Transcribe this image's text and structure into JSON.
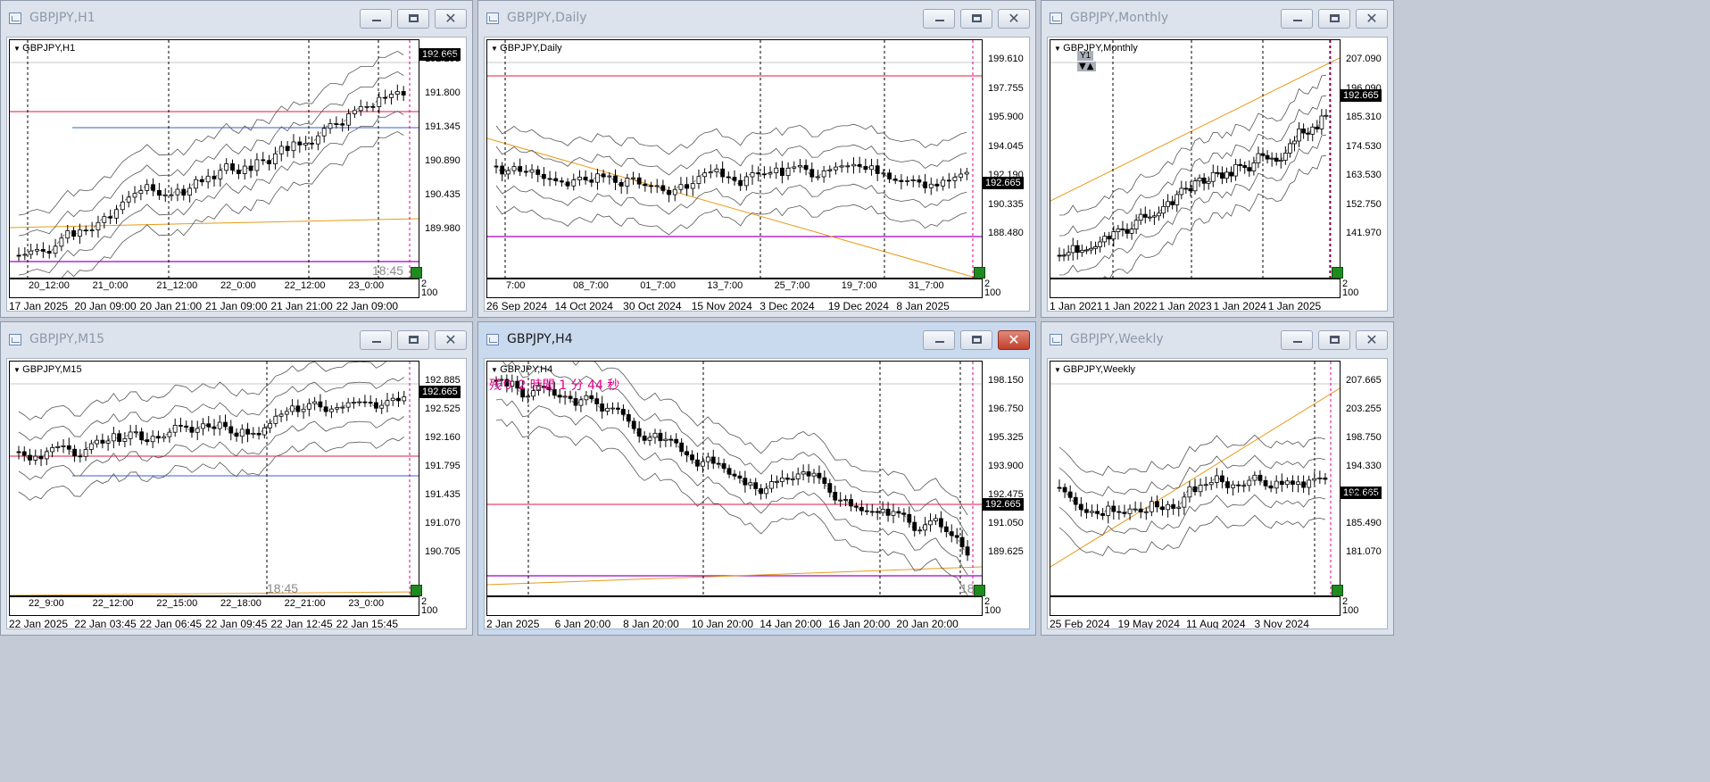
{
  "price": "192.665",
  "icons": {
    "window": "chart-window-icon"
  },
  "windows": [
    {
      "id": "h1",
      "title": "GBPJPY,H1",
      "label": "GBPJPY,H1",
      "active": false,
      "yticks": [
        "192.255",
        "191.800",
        "191.345",
        "190.890",
        "190.435",
        "189.980"
      ],
      "xticks": [
        "17 Jan 2025",
        "20 Jan 09:00",
        "20 Jan 21:00",
        "21 Jan 09:00",
        "21 Jan 21:00",
        "22 Jan 09:00"
      ],
      "sep": [
        "20_12:00",
        "21_0:00",
        "21_12:00",
        "22_0:00",
        "22_12:00",
        "23_0:00"
      ],
      "scale_top": "2",
      "scale_bottom": "100",
      "time": "18:45"
    },
    {
      "id": "daily",
      "title": "GBPJPY,Daily",
      "label": "GBPJPY,Daily",
      "active": false,
      "yticks": [
        "199.610",
        "197.755",
        "195.900",
        "194.045",
        "192.190",
        "190.335",
        "188.480"
      ],
      "xticks": [
        "26 Sep 2024",
        "14 Oct 2024",
        "30 Oct 2024",
        "15 Nov 2024",
        "3 Dec 2024",
        "19 Dec 2024",
        "8 Jan 2025"
      ],
      "sep": [
        "7:00",
        "08_7:00",
        "01_7:00",
        "13_7:00",
        "25_7:00",
        "19_7:00",
        "31_7:00"
      ],
      "scale_top": "2",
      "scale_bottom": "100"
    },
    {
      "id": "monthly",
      "title": "GBPJPY,Monthly",
      "label": "GBPJPY,Monthly",
      "active": false,
      "yticks": [
        "207.090",
        "196.090",
        "185.310",
        "174.530",
        "163.530",
        "152.750",
        "141.970"
      ],
      "xticks": [
        "1 Jan 2021",
        "1 Jan 2022",
        "1 Jan 2023",
        "1 Jan 2024",
        "1 Jan 2025"
      ],
      "indicator": "Y1",
      "scale_top": "2",
      "scale_bottom": "100"
    },
    {
      "id": "m15",
      "title": "GBPJPY,M15",
      "label": "GBPJPY,M15",
      "active": false,
      "yticks": [
        "192.885",
        "192.525",
        "192.160",
        "191.795",
        "191.435",
        "191.070",
        "190.705"
      ],
      "xticks": [
        "22 Jan 2025",
        "22 Jan 03:45",
        "22 Jan 06:45",
        "22 Jan 09:45",
        "22 Jan 12:45",
        "22 Jan 15:45"
      ],
      "sep": [
        "22_9:00",
        "22_12:00",
        "22_15:00",
        "22_18:00",
        "22_21:00",
        "23_0:00"
      ],
      "scale_top": "2",
      "scale_bottom": "100",
      "time": "18:45"
    },
    {
      "id": "h4",
      "title": "GBPJPY,H4",
      "label": "GBPJPY,H4",
      "active": true,
      "yticks": [
        "198.150",
        "196.750",
        "195.325",
        "193.900",
        "192.475",
        "191.050",
        "189.625"
      ],
      "xticks": [
        "2 Jan 2025",
        "6 Jan 20:00",
        "8 Jan 20:00",
        "10 Jan 20:00",
        "14 Jan 20:00",
        "16 Jan 20:00",
        "20 Jan 20:00"
      ],
      "countdown": "残り 2 時間 1 分 44 秒",
      "time": "18",
      "scale_top": "2",
      "scale_bottom": "100"
    },
    {
      "id": "weekly",
      "title": "GBPJPY,Weekly",
      "label": "GBPJPY,Weekly",
      "active": false,
      "yticks": [
        "207.665",
        "203.255",
        "198.750",
        "194.330",
        "189.910",
        "185.490",
        "181.070"
      ],
      "xticks": [
        "25 Feb 2024",
        "19 May 2024",
        "11 Aug 2024",
        "3 Nov 2024"
      ],
      "scale_top": "2",
      "scale_bottom": "100"
    }
  ]
}
